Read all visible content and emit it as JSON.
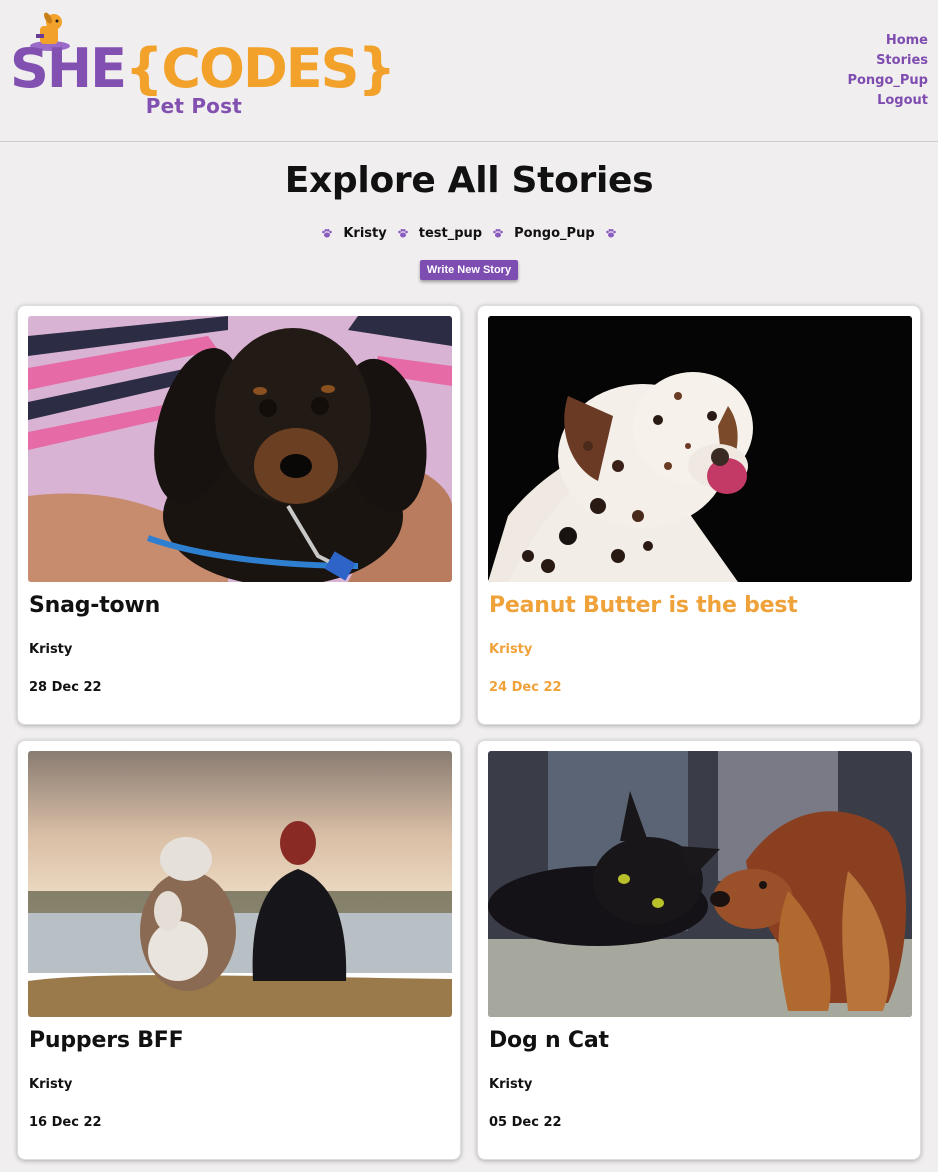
{
  "brand": {
    "logo_she": "SHE",
    "logo_codes": "{CODES}",
    "logo_sub": "Pet Post",
    "colors": {
      "purple": "#7f4db0",
      "orange": "#f2a22a"
    }
  },
  "nav": {
    "items": [
      {
        "label": "Home"
      },
      {
        "label": "Stories"
      },
      {
        "label": "Pongo_Pup"
      },
      {
        "label": "Logout"
      }
    ]
  },
  "main": {
    "title": "Explore All Stories",
    "authors": [
      {
        "label": "Kristy"
      },
      {
        "label": "test_pup"
      },
      {
        "label": "Pongo_Pup"
      }
    ],
    "write_button": "Write New Story"
  },
  "stories": [
    {
      "title": "Snag-town",
      "author": "Kristy",
      "date": "28 Dec 22",
      "image": "dachshund-puppy-photo",
      "hovered": false
    },
    {
      "title": "Peanut Butter is the best",
      "author": "Kristy",
      "date": "24 Dec 22",
      "image": "dalmatian-photo",
      "hovered": true
    },
    {
      "title": "Puppers BFF",
      "author": "Kristy",
      "date": "16 Dec 22",
      "image": "dog-and-girl-lake-photo",
      "hovered": false
    },
    {
      "title": "Dog n Cat",
      "author": "Kristy",
      "date": "05 Dec 22",
      "image": "cat-and-spaniel-photo",
      "hovered": false
    }
  ]
}
